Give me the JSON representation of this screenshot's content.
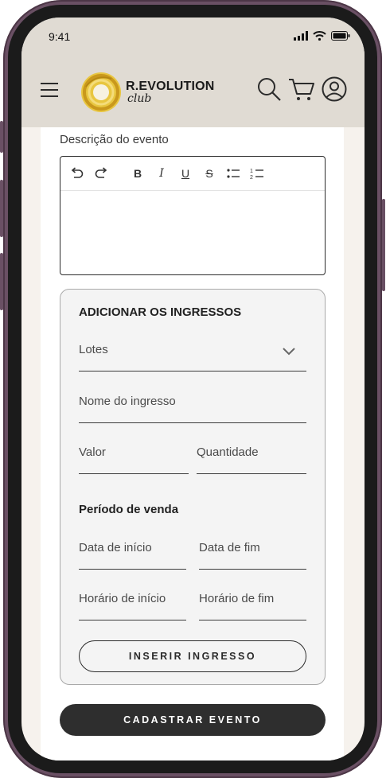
{
  "status_bar": {
    "time": "9:41"
  },
  "header": {
    "brand_name": "R.EVOLUTION",
    "brand_sub": "club"
  },
  "form": {
    "description_label": "Descrição do evento",
    "editor_toolbar": [
      "undo",
      "redo",
      "B",
      "I",
      "U",
      "S",
      "bullet-list",
      "numbered-list"
    ],
    "tickets": {
      "title": "ADICIONAR OS INGRESSOS",
      "lotes_placeholder": "Lotes",
      "ticket_name_placeholder": "Nome do ingresso",
      "value_placeholder": "Valor",
      "quantity_placeholder": "Quantidade",
      "sale_period_title": "Período de venda",
      "start_date_placeholder": "Data de início",
      "end_date_placeholder": "Data de fim",
      "start_time_placeholder": "Horário de início",
      "end_time_placeholder": "Horário de fim",
      "insert_button": "INSERIR INGRESSO"
    },
    "register_button": "CADASTRAR EVENTO"
  },
  "colors": {
    "header_bg": "#e0dbd3",
    "frame": "#6a5064",
    "primary_button": "#2e2e2e",
    "logo_gold": "#e0b62a"
  }
}
